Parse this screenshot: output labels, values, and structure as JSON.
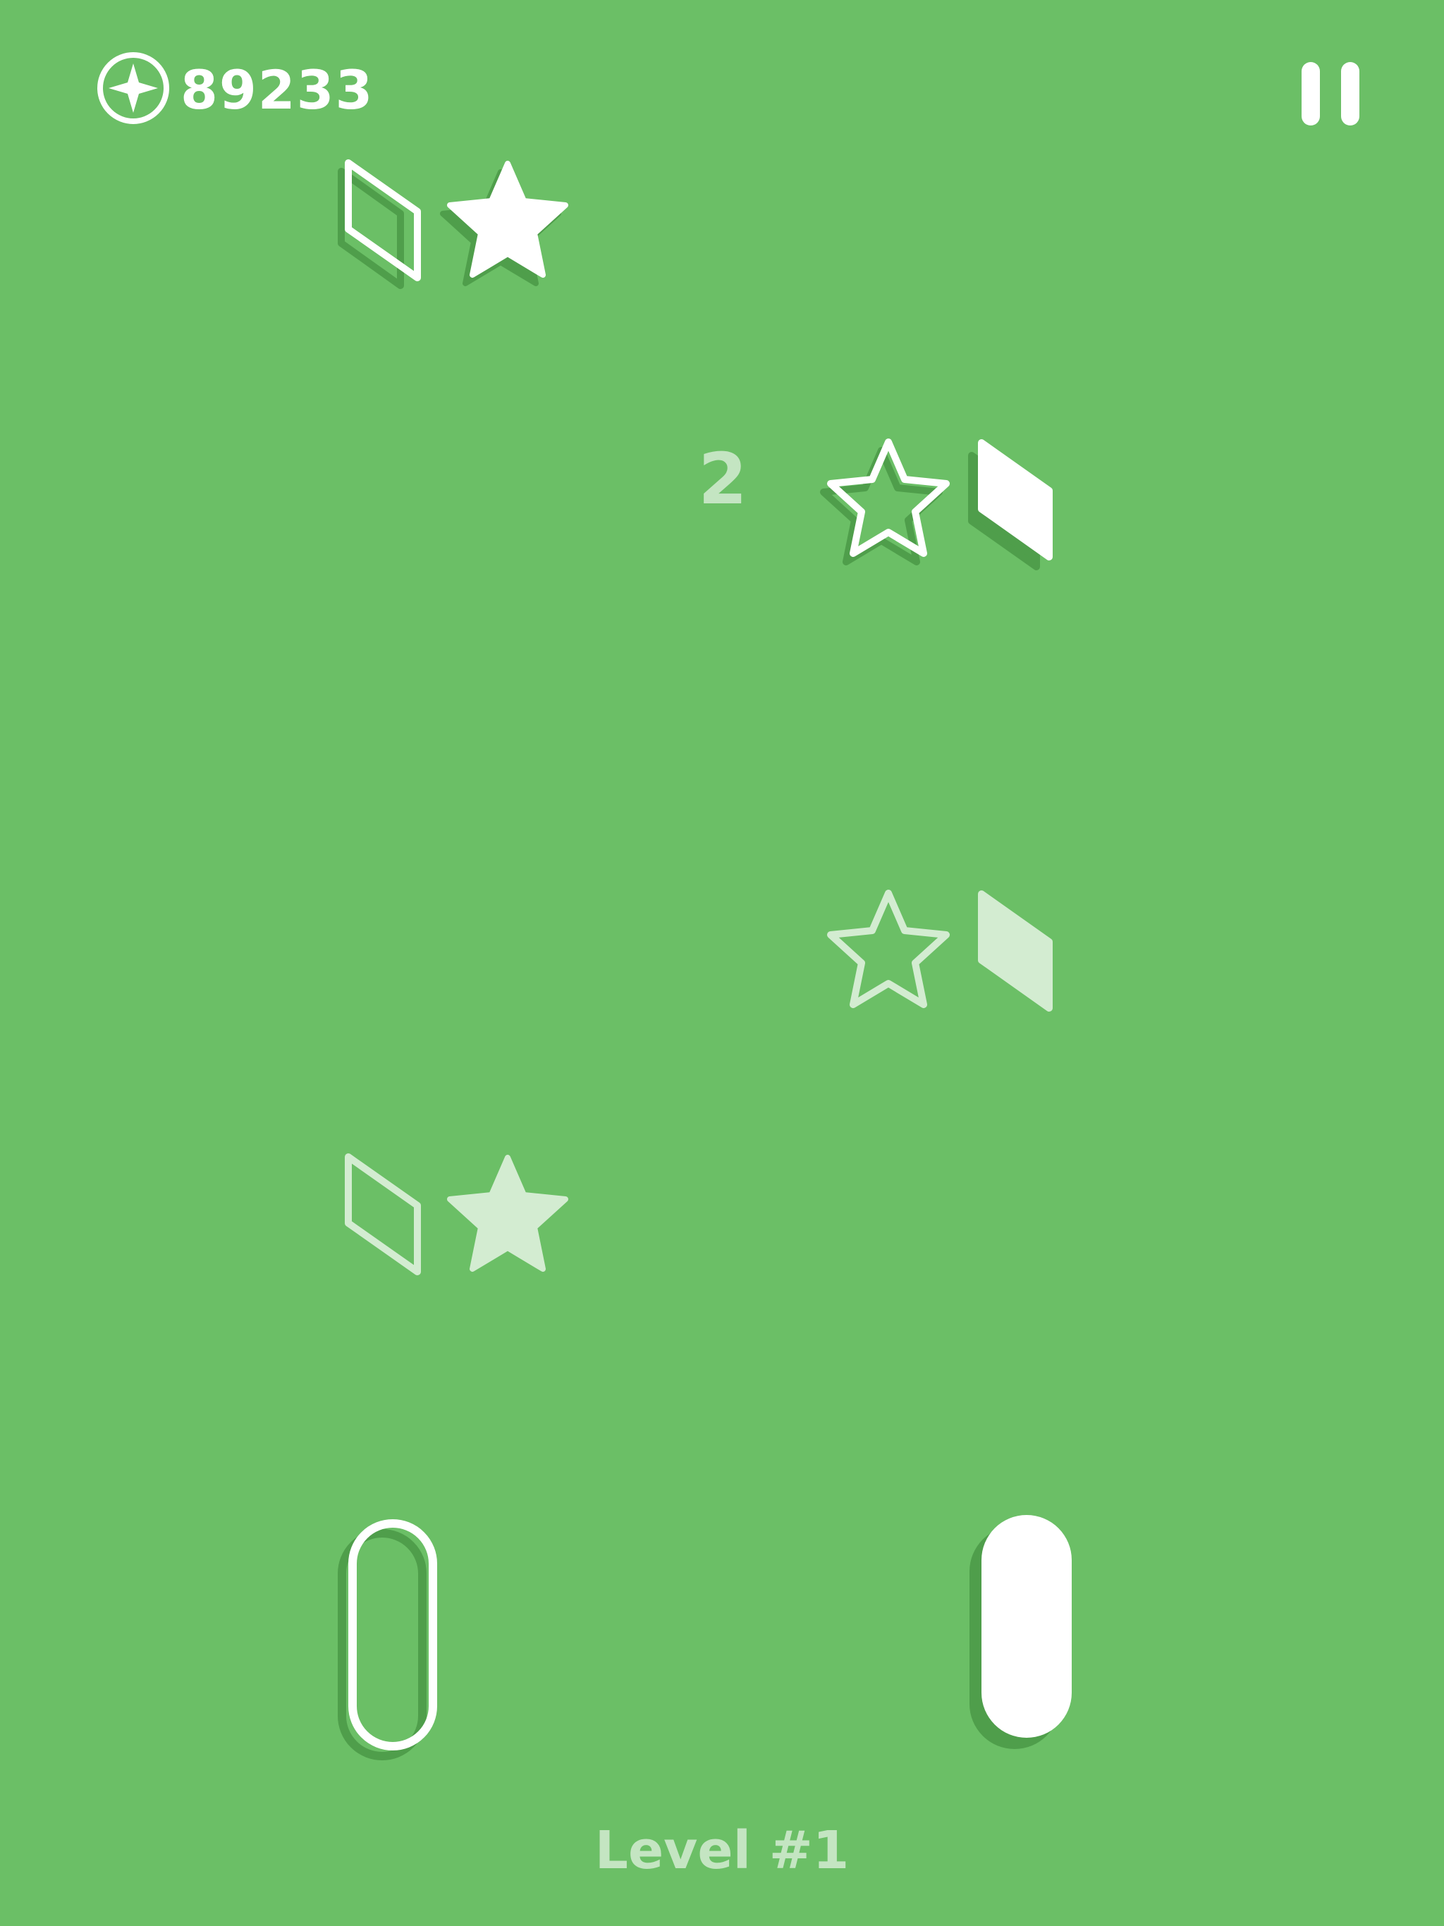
{
  "hud": {
    "coin_icon": "coin-sparkle-icon",
    "coins": "89233",
    "pause_icon": "pause-icon"
  },
  "board": {
    "combo_number": "2",
    "rows": [
      {
        "left_shape": "parallelogram-outline",
        "right_shape": "star-filled",
        "state": "active"
      },
      {
        "left_shape": "star-outline",
        "right_shape": "parallelogram-filled",
        "state": "active"
      },
      {
        "left_shape": "star-outline",
        "right_shape": "parallelogram-filled",
        "state": "faded"
      },
      {
        "left_shape": "parallelogram-outline",
        "right_shape": "star-filled",
        "state": "faded"
      }
    ]
  },
  "controls": {
    "left_paddle": "outline",
    "right_paddle": "filled"
  },
  "footer": {
    "level": "Level #1"
  },
  "colors": {
    "background": "#6bbf66",
    "shape": "#ffffff",
    "shadow": "#4f9e4b"
  }
}
